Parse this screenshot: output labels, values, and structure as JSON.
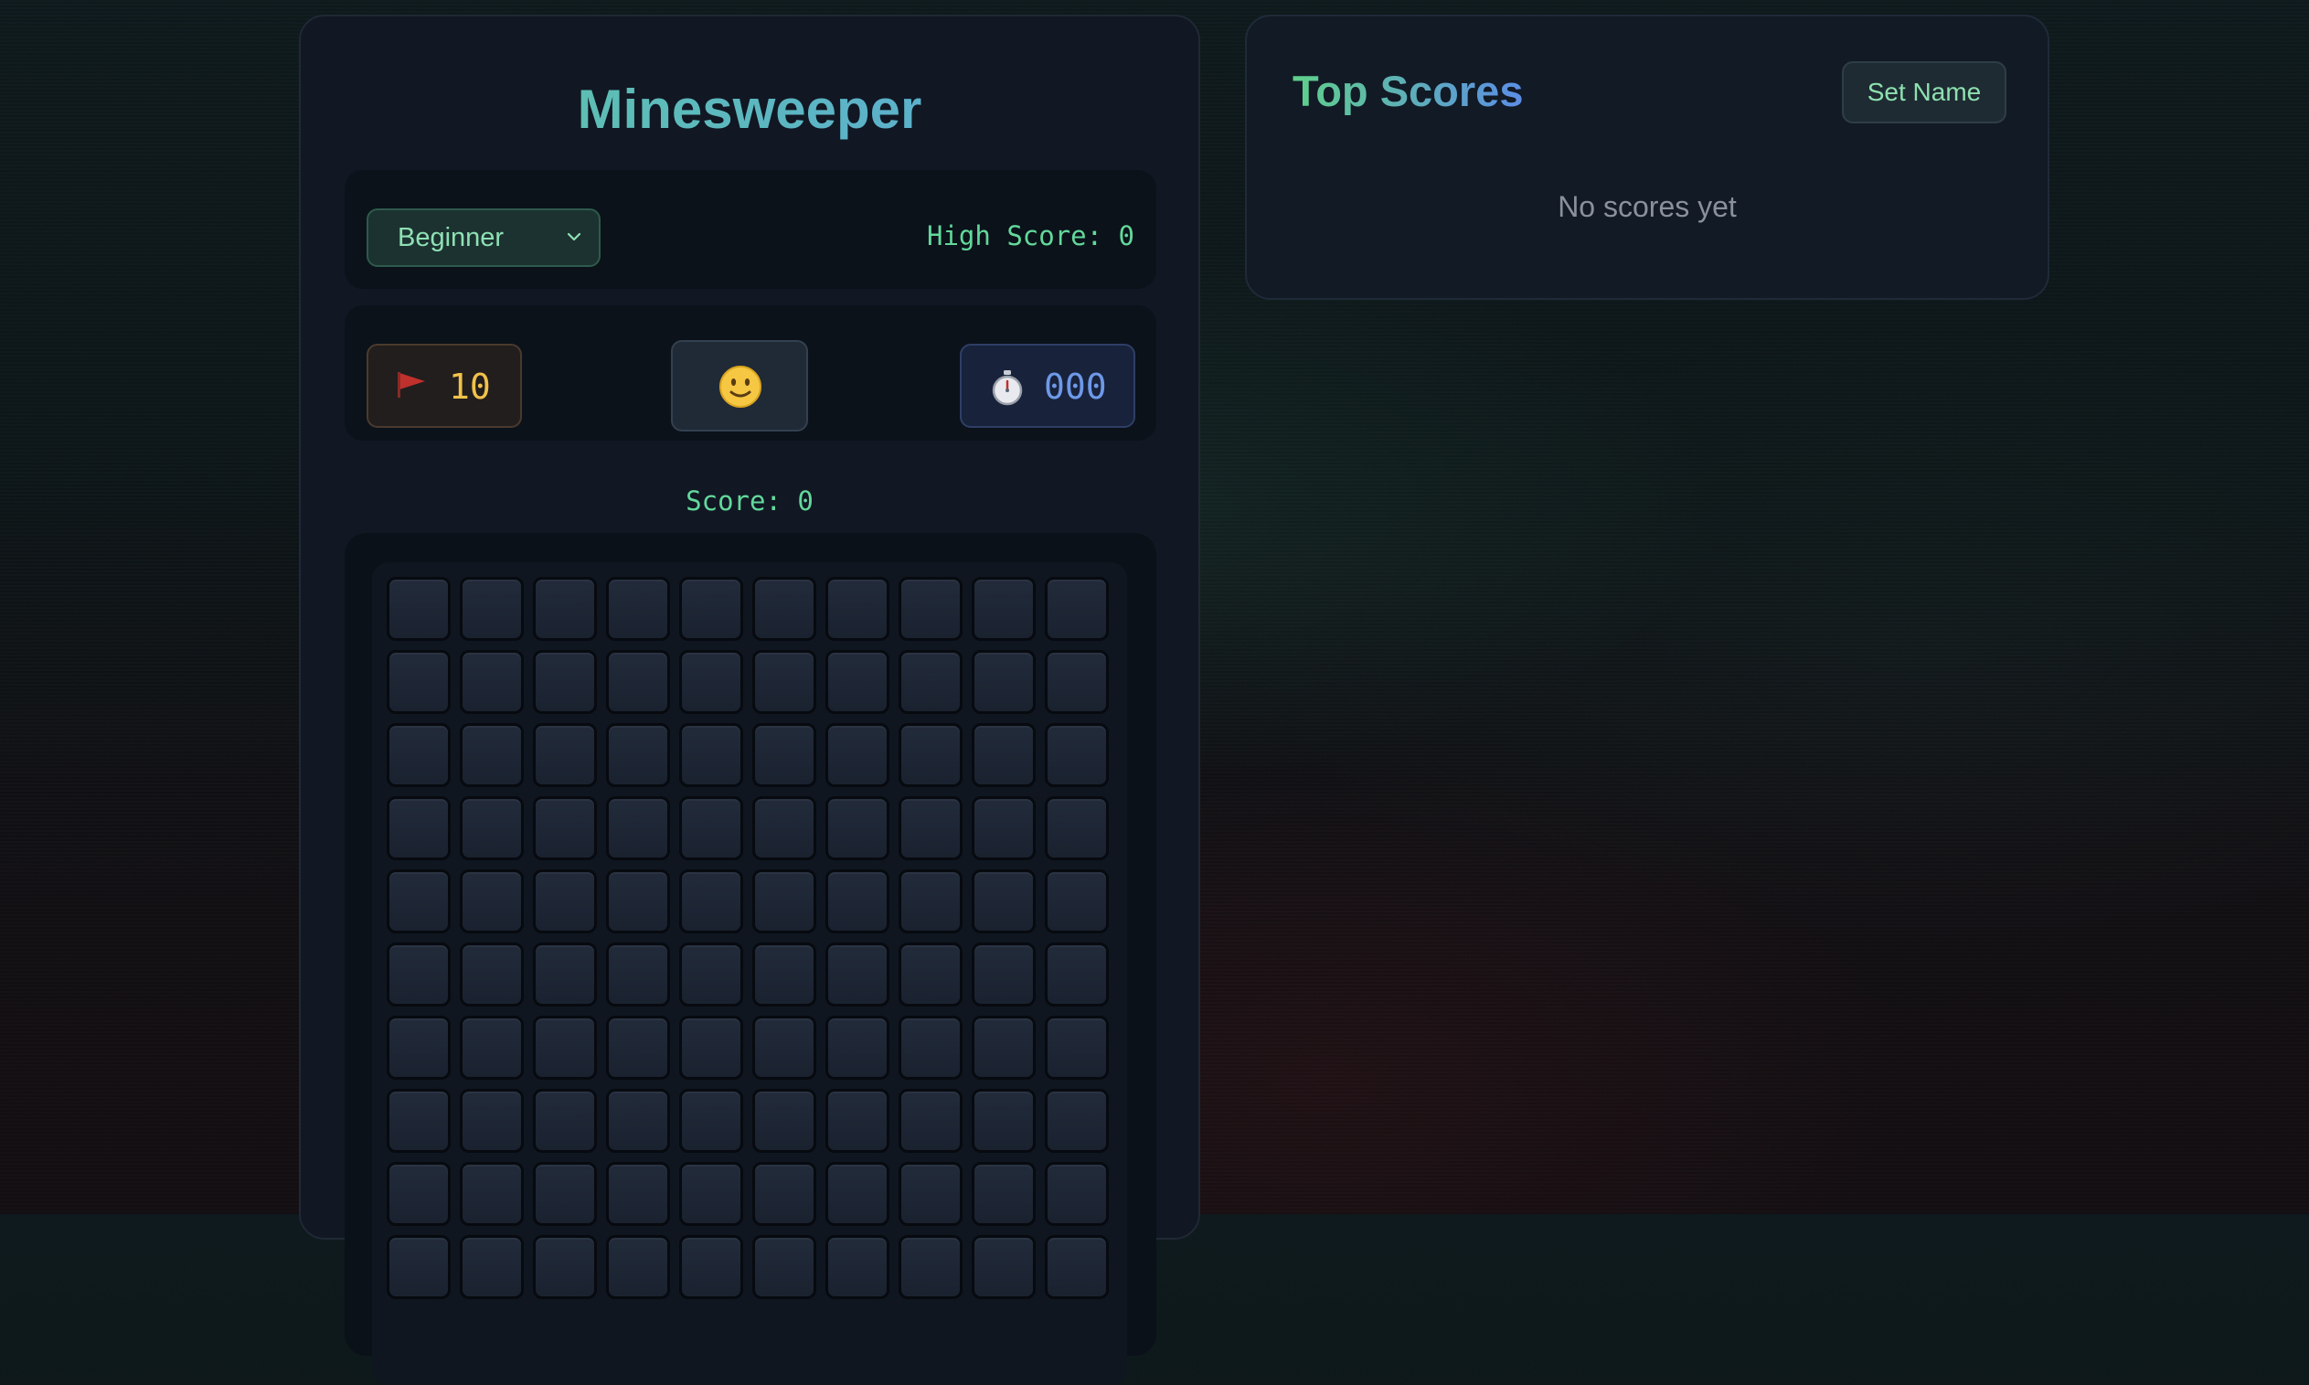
{
  "game": {
    "title": "Minesweeper",
    "difficulty": {
      "selected": "Beginner"
    },
    "high_score_text": "High Score: 0",
    "flags_remaining": "10",
    "timer": "000",
    "score_text": "Score: 0",
    "board": {
      "columns": 10,
      "cell_state": "unrevealed"
    },
    "icons": {
      "flag": "flag-icon",
      "reset": "slightly-smiling-face-icon",
      "timer": "stopwatch-icon",
      "dropdown": "chevron-down-icon"
    }
  },
  "scores": {
    "title": "Top Scores",
    "set_name_label": "Set Name",
    "empty_message": "No scores yet"
  },
  "colors": {
    "accent_green": "#63d89b",
    "flag_count": "#f0c24a",
    "timer": "#6e99e8",
    "panel_bg": "#111823"
  }
}
